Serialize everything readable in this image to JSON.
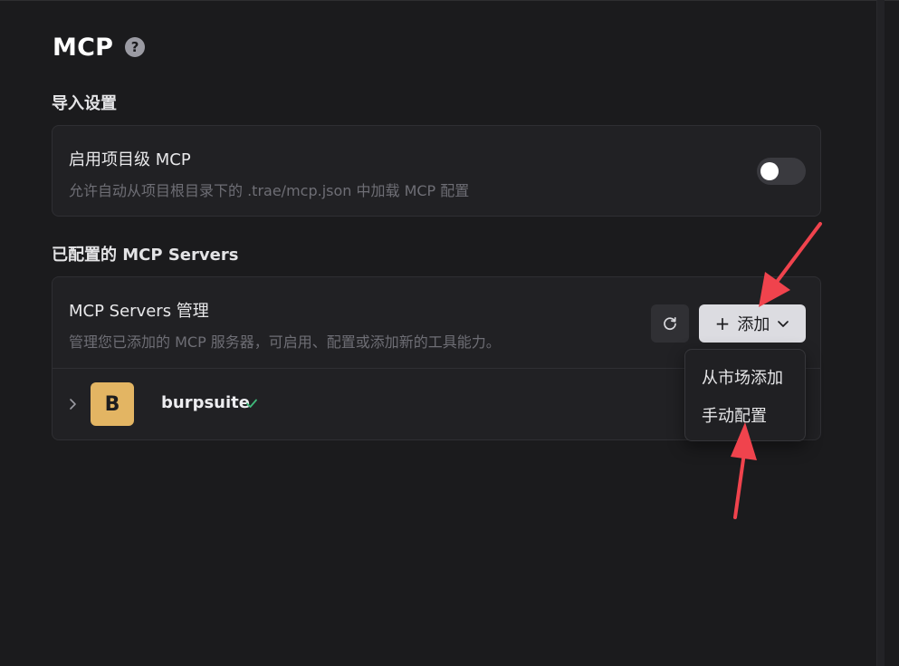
{
  "header": {
    "title": "MCP",
    "help_icon_glyph": "?"
  },
  "import_settings": {
    "section_title": "导入设置",
    "project_mcp": {
      "title": "启用项目级 MCP",
      "description": "允许自动从项目根目录下的 .trae/mcp.json 中加载 MCP 配置",
      "enabled": false
    }
  },
  "servers_section": {
    "section_title": "已配置的 MCP Servers",
    "manager": {
      "title": "MCP Servers 管理",
      "description": "管理您已添加的 MCP 服务器，可启用、配置或添加新的工具能力。",
      "refresh_icon": "refresh-icon",
      "add_button": {
        "plus": "+",
        "label": "添加"
      }
    },
    "servers": [
      {
        "avatar_letter": "B",
        "avatar_color": "#e3b563",
        "name": "burpsuite",
        "status": "connected",
        "status_color": "#3fb97a"
      }
    ]
  },
  "add_dropdown": {
    "items": [
      {
        "label": "从市场添加"
      },
      {
        "label": "手动配置"
      }
    ]
  },
  "colors": {
    "background": "#1b1b1d",
    "card": "#212124",
    "annotation_arrow": "#f0434d"
  }
}
